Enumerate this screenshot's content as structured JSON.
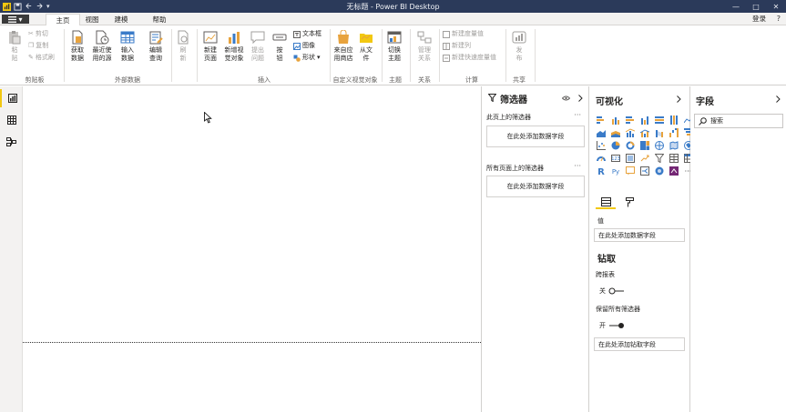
{
  "window": {
    "title": "无标题 - Power BI Desktop",
    "controls": [
      "—",
      "□",
      "✕"
    ]
  },
  "tabs": {
    "file_label": "▾",
    "items": [
      "主页",
      "视图",
      "建模",
      "帮助"
    ],
    "signin": "登录",
    "help": "?"
  },
  "ribbon": {
    "clipboard": {
      "paste": "粘\n贴",
      "cut": "剪切",
      "copy": "复制",
      "format_painter": "格式刷",
      "group": "剪贴板"
    },
    "external_data": {
      "get_data": "获取\n数据",
      "recent_sources": "最近使\n用的源",
      "enter_data": "输入\n数据",
      "edit_queries": "编辑\n查询",
      "group": "外部数据"
    },
    "refresh": "刷\n新",
    "insert": {
      "new_page": "新建\n页面",
      "new_visual": "新增视\n觉对象",
      "ask_question": "提出\n问题",
      "buttons": "按\n钮",
      "textbox": "文本框",
      "image": "图像",
      "shapes": "形状",
      "group": "插入"
    },
    "custom_visuals": {
      "from_store": "来自应\n用商店",
      "from_file": "从文\n件",
      "group": "自定义视觉对象"
    },
    "themes": {
      "switch_theme": "切换\n主题",
      "group": "主题"
    },
    "relationships": {
      "manage": "管理\n关系",
      "group": "关系"
    },
    "calculations": {
      "new_measure": "新建度量值",
      "new_column": "新建列",
      "new_quick_measure": "新建快速度量值",
      "group": "计算"
    },
    "share": {
      "publish": "发\n布",
      "group": "共享"
    }
  },
  "filters": {
    "title": "筛选器",
    "page_level_label": "此页上的筛选器",
    "page_level_drop": "在此处添加数据字段",
    "all_pages_label": "所有页面上的筛选器",
    "all_pages_drop": "在此处添加数据字段",
    "more": "···"
  },
  "visualizations": {
    "title": "可视化",
    "more": "···",
    "values_label": "值",
    "values_drop": "在此处添加数据字段",
    "drillthrough_title": "钻取",
    "cross_report_label": "跨报表",
    "cross_report_state": "关",
    "keep_filters_label": "保留所有筛选器",
    "keep_filters_state": "开",
    "drillthrough_drop": "在此处添加钻取字段"
  },
  "fields": {
    "title": "字段",
    "search_placeholder": "搜索"
  },
  "colors": {
    "accent": "#f2c811",
    "titlebar": "#2b3a5a",
    "icon_blue": "#3a7bc8",
    "icon_orange": "#e8a33d"
  }
}
